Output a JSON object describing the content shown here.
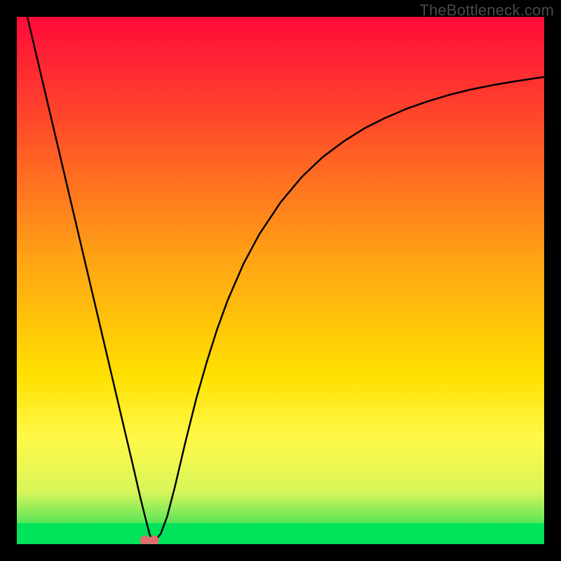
{
  "watermark": "TheBottleneck.com",
  "chart_data": {
    "type": "line",
    "title": "",
    "xlabel": "",
    "ylabel": "",
    "xlim": [
      0,
      100
    ],
    "ylim": [
      0,
      100
    ],
    "grid": false,
    "legend": false,
    "background_gradient": {
      "top_color": "#ff0a3a",
      "mid_color": "#ffd000",
      "bottom_color": "#00e35a",
      "bottom_band_start_pct": 78,
      "solid_green_start_pct": 96
    },
    "series": [
      {
        "name": "bottleneck-curve",
        "color": "#000000",
        "stroke_width": 2.5,
        "x": [
          2,
          4,
          6,
          8,
          10,
          12,
          14,
          16,
          18,
          20,
          22,
          23.5,
          24.5,
          25.2,
          25.8,
          26.3,
          27.3,
          28.5,
          30,
          32,
          34,
          36,
          38,
          40,
          43,
          46,
          50,
          54,
          58,
          62,
          66,
          70,
          74,
          78,
          82,
          86,
          90,
          94,
          98,
          100
        ],
        "y": [
          100,
          91.5,
          83,
          74.5,
          66,
          57.5,
          49,
          40.5,
          32,
          23.5,
          15,
          8.5,
          4.5,
          1.8,
          0.7,
          0.7,
          2.0,
          5.2,
          11.0,
          19.5,
          27.5,
          34.5,
          40.8,
          46.3,
          53.2,
          58.8,
          64.8,
          69.6,
          73.4,
          76.4,
          78.9,
          80.9,
          82.6,
          84.0,
          85.2,
          86.2,
          87.0,
          87.7,
          88.3,
          88.6
        ]
      }
    ],
    "markers": [
      {
        "name": "marker-a",
        "x": 24.3,
        "y": 0.7,
        "color": "#e46a6f",
        "r": 7
      },
      {
        "name": "marker-b",
        "x": 26.0,
        "y": 0.7,
        "color": "#e46a6f",
        "r": 7
      }
    ]
  }
}
